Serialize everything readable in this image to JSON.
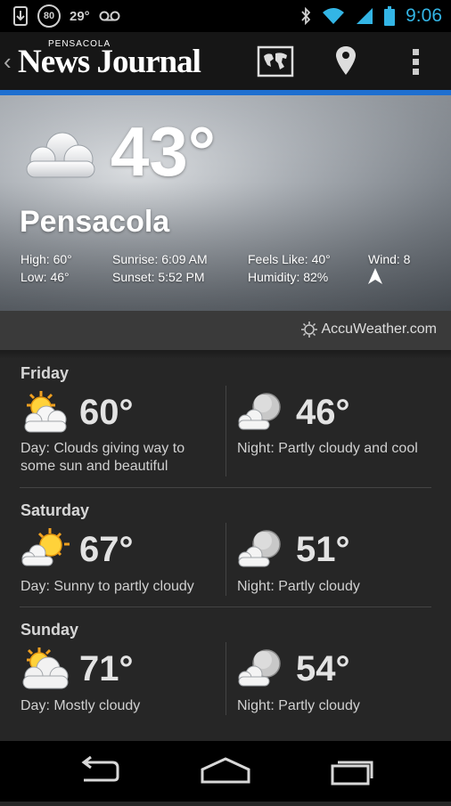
{
  "status_bar": {
    "left_badge": "80",
    "temperature": "29°",
    "clock": "9:06",
    "accent_color": "#33b5e5"
  },
  "app_bar": {
    "logo_small": "PENSACOLA",
    "logo_main": "News Journal",
    "icons": [
      "back-chevron-icon",
      "world-map-icon",
      "location-pin-icon",
      "overflow-menu-icon"
    ],
    "accent_color": "#1e6fd0"
  },
  "current": {
    "temp": "43°",
    "city": "Pensacola",
    "high": "High: 60°",
    "low": "Low: 46°",
    "sunrise": "Sunrise: 6:09 AM",
    "sunset": "Sunset: 5:52 PM",
    "feels_like": "Feels Like: 40°",
    "humidity": "Humidity: 82%",
    "wind": "Wind: 8",
    "icon": "cloudy-icon"
  },
  "attribution": "AccuWeather.com",
  "forecast": [
    {
      "day": "Friday",
      "day_temp": "60°",
      "day_desc": "Day: Clouds giving way to some sun and beautiful",
      "day_icon": "partly-sunny-icon",
      "night_temp": "46°",
      "night_desc": "Night: Partly cloudy and cool",
      "night_icon": "partly-cloudy-night-icon"
    },
    {
      "day": "Saturday",
      "day_temp": "67°",
      "day_desc": "Day: Sunny to partly cloudy",
      "day_icon": "mostly-sunny-icon",
      "night_temp": "51°",
      "night_desc": "Night: Partly cloudy",
      "night_icon": "partly-cloudy-night-icon"
    },
    {
      "day": "Sunday",
      "day_temp": "71°",
      "day_desc": "Day: Mostly cloudy",
      "day_icon": "mostly-cloudy-icon",
      "night_temp": "54°",
      "night_desc": "Night: Partly cloudy",
      "night_icon": "partly-cloudy-night-icon"
    }
  ],
  "nav_bar": {
    "icons": [
      "back-icon",
      "home-icon",
      "recent-apps-icon"
    ]
  }
}
